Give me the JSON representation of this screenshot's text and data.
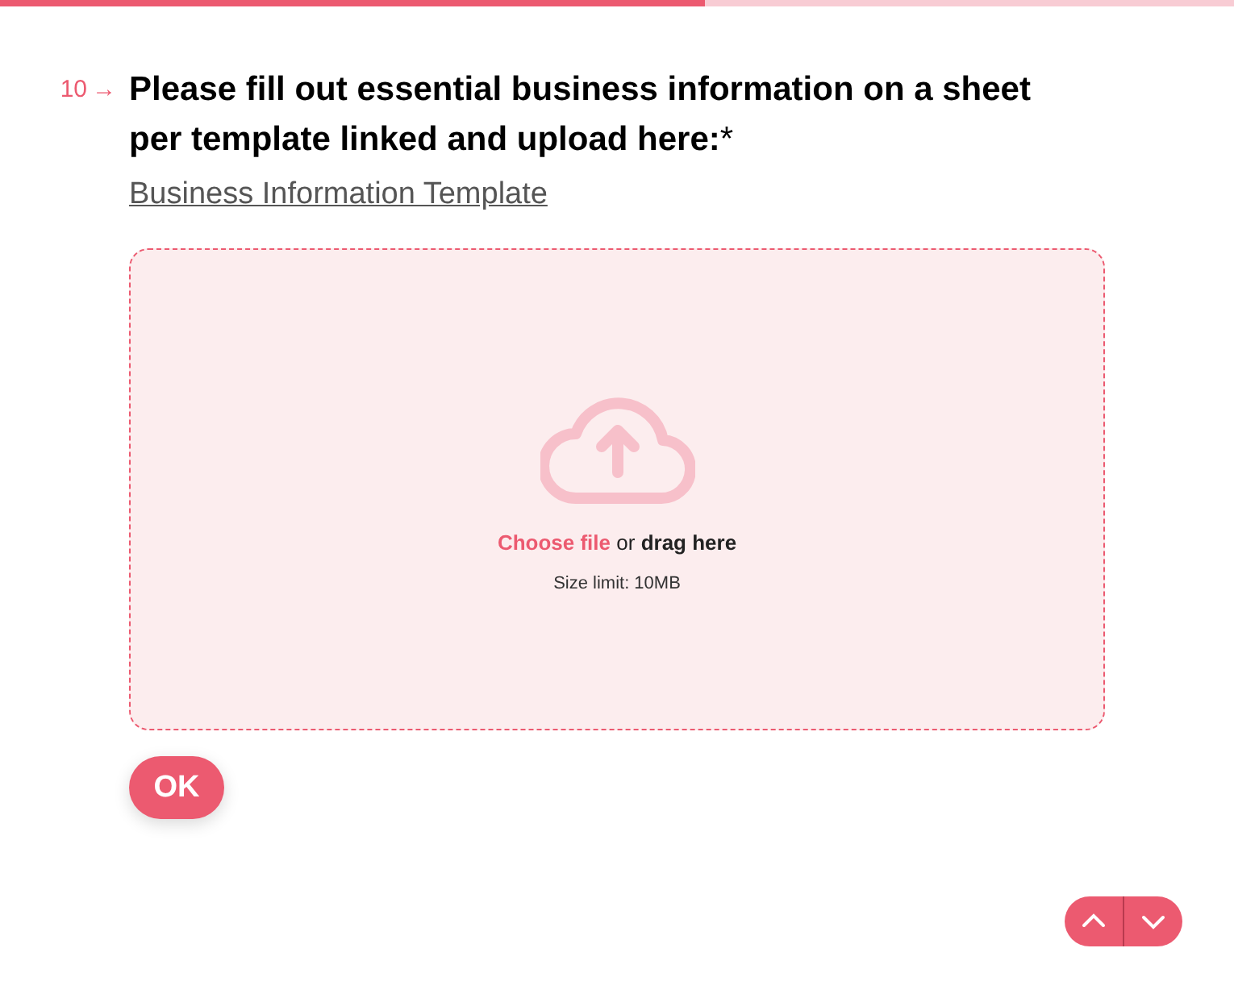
{
  "progress": {
    "level": 0.571
  },
  "question": {
    "number": "10",
    "arrow": "→",
    "title": "Please fill out essential business information on a sheet per template linked and upload here:",
    "required_mark": "*",
    "link": "Business Information Template"
  },
  "upload": {
    "choose": "Choose file",
    "rest": " or **drag here**",
    "limit": "Size limit: 10MB"
  },
  "ok_button": "OK",
  "nav": [
    {
      "kind": "up"
    },
    {
      "kind": "down"
    }
  ]
}
